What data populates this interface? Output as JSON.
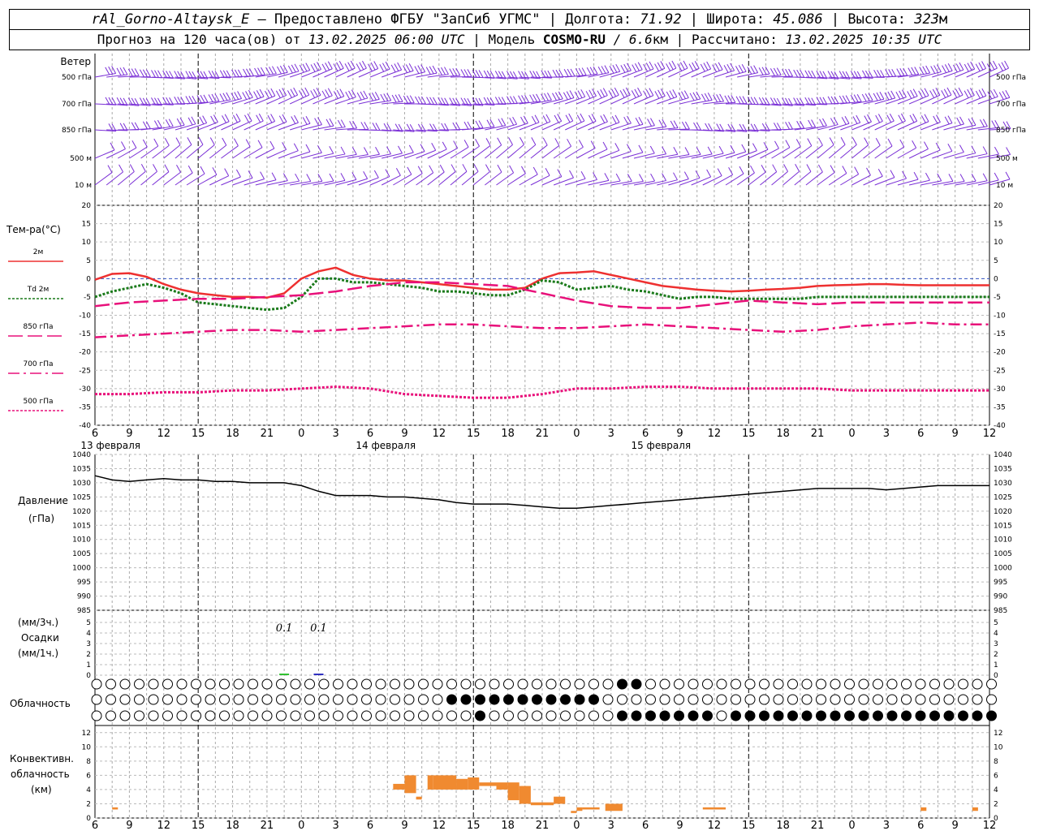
{
  "header": {
    "station": "rAl_Gorno-Altaysk_E",
    "provided_prefix": "– Предоставлено ФГБУ \"ЗапСиб УГМС\"",
    "lon_label": "Долгота:",
    "lon_value": "71.92",
    "lat_label": "Широта:",
    "lat_value": "45.086",
    "alt_label": "Высота:",
    "alt_value": "323",
    "alt_unit": "м",
    "forecast_prefix": "Прогноз на 120 часа(ов) от",
    "forecast_time": "13.02.2025 06:00 UTC",
    "model_label": "| Модель",
    "model_name": "COSMO-RU",
    "model_res": "/ 6.6",
    "model_res_unit": "км",
    "calc_label": "| Рассчитано:",
    "calc_time": "13.02.2025 10:35 UTC"
  },
  "x_ticks": [
    "6",
    "9",
    "12",
    "15",
    "18",
    "21",
    "0",
    "3",
    "6",
    "9",
    "12",
    "15",
    "18",
    "21",
    "0",
    "3",
    "6",
    "9",
    "12",
    "15",
    "18",
    "21",
    "0",
    "3",
    "6",
    "9",
    "12"
  ],
  "dates": [
    "13 февраля",
    "14 февраля",
    "15 февраля"
  ],
  "wind": {
    "title": "Ветер",
    "levels": [
      "500 гПа",
      "700 гПа",
      "850 гПа",
      "500 м",
      "10 м"
    ],
    "color": "#7a2fd6"
  },
  "temperature": {
    "title": "Тем-ра(°С)",
    "legend": [
      {
        "label": "2м",
        "color": "#ee3030",
        "dash": "solid"
      },
      {
        "label": "Td  2м",
        "color": "#1a7a1a",
        "dash": "dotted"
      },
      {
        "label": "850 гПа",
        "color": "#e8107a",
        "dash": "long-dash"
      },
      {
        "label": "700 гПа",
        "color": "#e8107a",
        "dash": "dash-dot"
      },
      {
        "label": "500 гПа",
        "color": "#e8107a",
        "dash": "dotted"
      }
    ],
    "y_ticks": [
      "20",
      "15",
      "10",
      "5",
      "0",
      "-5",
      "-10",
      "-15",
      "-20",
      "-25",
      "-30",
      "-35",
      "-40"
    ]
  },
  "pressure": {
    "title": "Давление",
    "unit": "(гПа)",
    "y_ticks": [
      "1040",
      "1035",
      "1030",
      "1025",
      "1020",
      "1015",
      "1010",
      "1005",
      "1000",
      "995",
      "990",
      "985"
    ]
  },
  "precip": {
    "unit_top": "(мм/3ч.)",
    "title": "Осадки",
    "unit_bottom": "(мм/1ч.)",
    "y_ticks": [
      "5",
      "4",
      "3",
      "2",
      "1",
      "0"
    ],
    "labels": [
      {
        "hour": 33,
        "text": "0.1"
      },
      {
        "hour": 39,
        "text": "0.1"
      }
    ]
  },
  "cloud": {
    "title": "Облачность"
  },
  "convective": {
    "title_1": "Конвективн.",
    "title_2": "облачность",
    "title_3": "(км)",
    "y_ticks": [
      "12",
      "10",
      "8",
      "6",
      "4",
      "2",
      "0"
    ],
    "color": "#f08a30"
  },
  "chart_data": [
    {
      "type": "line",
      "title": "Тем-ра(°С)",
      "x_unit": "hours from 13.02.2025 06:00 UTC",
      "ylim": [
        -40,
        20
      ],
      "series": [
        {
          "name": "2м",
          "x": [
            0,
            3,
            6,
            9,
            12,
            15,
            18,
            21,
            24,
            27,
            30,
            33,
            36,
            39,
            42,
            45,
            48,
            51,
            54,
            57,
            60,
            63,
            66,
            69,
            72,
            75,
            78,
            81,
            84,
            87,
            90,
            93,
            96,
            99,
            102,
            105,
            108,
            111,
            114,
            117,
            120,
            123,
            126,
            129,
            132,
            135,
            138,
            141,
            144,
            147,
            150,
            153,
            156
          ],
          "values": [
            -0.3,
            1.3,
            1.5,
            0.5,
            -1.5,
            -3,
            -4,
            -4.5,
            -5,
            -5,
            -5.2,
            -4,
            0,
            2,
            3,
            1,
            0,
            -0.5,
            -0.5,
            -1,
            -1.5,
            -2,
            -2.5,
            -3,
            -3,
            -2.5,
            0,
            1.5,
            1.7,
            2,
            1,
            0,
            -1,
            -2,
            -2.5,
            -3,
            -3.3,
            -3.5,
            -3.3,
            -3,
            -2.8,
            -2.5,
            -2,
            -1.8,
            -1.7,
            -1.5,
            -1.5,
            -1.7,
            -1.8,
            -1.8,
            -1.8,
            -1.8,
            -1.8
          ]
        },
        {
          "name": "Td 2м",
          "x": [
            0,
            3,
            6,
            9,
            12,
            15,
            18,
            21,
            24,
            27,
            30,
            33,
            36,
            39,
            42,
            45,
            48,
            51,
            54,
            57,
            60,
            63,
            66,
            69,
            72,
            75,
            78,
            81,
            84,
            87,
            90,
            93,
            96,
            99,
            102,
            105,
            108,
            111,
            114,
            117,
            120,
            123,
            126,
            129,
            132,
            135,
            138,
            141,
            144,
            147,
            150,
            153,
            156
          ],
          "values": [
            -5,
            -3.5,
            -2.5,
            -1.5,
            -2.5,
            -4,
            -6.5,
            -7,
            -7.5,
            -8,
            -8.5,
            -8,
            -5,
            0,
            0,
            -1,
            -1,
            -1.5,
            -2,
            -2.5,
            -3.5,
            -3.5,
            -4,
            -4.5,
            -4.5,
            -3,
            -0.5,
            -1,
            -3,
            -2.5,
            -2,
            -3,
            -3.5,
            -4.5,
            -5.5,
            -5,
            -5,
            -5.5,
            -5.5,
            -5.5,
            -5.5,
            -5.5,
            -5,
            -5,
            -5,
            -5,
            -5,
            -5,
            -5,
            -5,
            -5,
            -5,
            -5
          ]
        },
        {
          "name": "850 гПа",
          "x": [
            0,
            6,
            12,
            18,
            24,
            30,
            36,
            42,
            48,
            54,
            60,
            66,
            72,
            78,
            84,
            90,
            96,
            102,
            108,
            114,
            120,
            126,
            132,
            138,
            144,
            150,
            156
          ],
          "values": [
            -7.5,
            -6.5,
            -6,
            -5.5,
            -5.5,
            -5,
            -4.5,
            -3.5,
            -2,
            -1,
            -1,
            -1.5,
            -2,
            -4,
            -6,
            -7.5,
            -8,
            -8,
            -7,
            -6,
            -6.5,
            -7,
            -6.5,
            -6.5,
            -6.5,
            -6.5,
            -6.5
          ]
        },
        {
          "name": "700 гПа",
          "x": [
            0,
            6,
            12,
            18,
            24,
            30,
            36,
            42,
            48,
            54,
            60,
            66,
            72,
            78,
            84,
            90,
            96,
            102,
            108,
            114,
            120,
            126,
            132,
            138,
            144,
            150,
            156
          ],
          "values": [
            -16,
            -15.5,
            -15,
            -14.5,
            -14,
            -14,
            -14.5,
            -14,
            -13.5,
            -13,
            -12.5,
            -12.5,
            -13,
            -13.5,
            -13.5,
            -13,
            -12.5,
            -13,
            -13.5,
            -14,
            -14.5,
            -14,
            -13,
            -12.5,
            -12,
            -12.5,
            -12.5
          ]
        },
        {
          "name": "500 гПа",
          "x": [
            0,
            6,
            12,
            18,
            24,
            30,
            36,
            42,
            48,
            54,
            60,
            66,
            72,
            78,
            84,
            90,
            96,
            102,
            108,
            114,
            120,
            126,
            132,
            138,
            144,
            150,
            156
          ],
          "values": [
            -31.5,
            -31.5,
            -31,
            -31,
            -30.5,
            -30.5,
            -30,
            -29.5,
            -30,
            -31.5,
            -32,
            -32.5,
            -32.5,
            -31.5,
            -30,
            -30,
            -29.5,
            -29.5,
            -30,
            -30,
            -30,
            -30,
            -30.5,
            -30.5,
            -30.5,
            -30.5,
            -30.5
          ]
        }
      ]
    },
    {
      "type": "line",
      "title": "Давление",
      "ylabel": "(гПа)",
      "x_unit": "hours from 13.02.2025 06:00 UTC",
      "ylim": [
        985,
        1040
      ],
      "series": [
        {
          "name": "Давление",
          "x": [
            0,
            3,
            6,
            9,
            12,
            15,
            18,
            21,
            24,
            27,
            30,
            33,
            36,
            39,
            42,
            45,
            48,
            51,
            54,
            57,
            60,
            63,
            66,
            69,
            72,
            75,
            78,
            81,
            84,
            87,
            90,
            93,
            96,
            99,
            102,
            105,
            108,
            111,
            114,
            117,
            120,
            123,
            126,
            129,
            132,
            135,
            138,
            141,
            144,
            147,
            150,
            153,
            156
          ],
          "values": [
            1032.5,
            1031,
            1030.5,
            1031,
            1031.5,
            1031,
            1031,
            1030.5,
            1030.5,
            1030,
            1030,
            1030,
            1029,
            1027,
            1025.5,
            1025.5,
            1025.5,
            1025,
            1025,
            1024.5,
            1024,
            1023,
            1022.5,
            1022.5,
            1022.5,
            1022,
            1021.5,
            1021,
            1021,
            1021.5,
            1022,
            1022.5,
            1023,
            1023.5,
            1024,
            1024.5,
            1025,
            1025.5,
            1026,
            1026.5,
            1027,
            1027.5,
            1028,
            1028,
            1028,
            1028,
            1027.5,
            1028,
            1028.5,
            1029,
            1029,
            1029,
            1029
          ]
        }
      ]
    },
    {
      "type": "bar",
      "title": "Осадки",
      "ylabel": "(мм/3ч.)",
      "x_unit": "hours from 13.02.2025 06:00 UTC",
      "ylim": [
        0,
        5
      ],
      "series": [
        {
          "name": "мм/3ч.",
          "x": [
            33,
            39
          ],
          "values": [
            0.1,
            0.1
          ]
        }
      ]
    },
    {
      "type": "bar",
      "title": "Конвективн. облачность",
      "ylabel": "(км)",
      "x_unit": "hours from 13.02.2025 06:00 UTC",
      "ylim": [
        0,
        13
      ],
      "series": [
        {
          "name": "Конвективн. облачность",
          "segments": [
            {
              "x0": 3,
              "x1": 4,
              "bottom": 1.2,
              "top": 1.5
            },
            {
              "x0": 52,
              "x1": 54,
              "bottom": 4,
              "top": 4.8
            },
            {
              "x0": 54,
              "x1": 56,
              "bottom": 3.5,
              "top": 6
            },
            {
              "x0": 56,
              "x1": 57,
              "bottom": 2.6,
              "top": 3
            },
            {
              "x0": 58,
              "x1": 59,
              "bottom": 4,
              "top": 6
            },
            {
              "x0": 59,
              "x1": 63,
              "bottom": 4,
              "top": 6
            },
            {
              "x0": 63,
              "x1": 65,
              "bottom": 4,
              "top": 5.5
            },
            {
              "x0": 65,
              "x1": 67,
              "bottom": 4,
              "top": 5.7
            },
            {
              "x0": 67,
              "x1": 70,
              "bottom": 4.5,
              "top": 5
            },
            {
              "x0": 70,
              "x1": 72,
              "bottom": 4,
              "top": 5
            },
            {
              "x0": 72,
              "x1": 74,
              "bottom": 2.5,
              "top": 5
            },
            {
              "x0": 74,
              "x1": 76,
              "bottom": 2,
              "top": 4.5
            },
            {
              "x0": 76,
              "x1": 78,
              "bottom": 1.8,
              "top": 2.2
            },
            {
              "x0": 78,
              "x1": 80,
              "bottom": 1.8,
              "top": 2.2
            },
            {
              "x0": 80,
              "x1": 82,
              "bottom": 2,
              "top": 3
            },
            {
              "x0": 83,
              "x1": 84,
              "bottom": 0.7,
              "top": 1
            },
            {
              "x0": 84,
              "x1": 85,
              "bottom": 1,
              "top": 1.5
            },
            {
              "x0": 85,
              "x1": 88,
              "bottom": 1.2,
              "top": 1.5
            },
            {
              "x0": 89,
              "x1": 92,
              "bottom": 1,
              "top": 2
            },
            {
              "x0": 106,
              "x1": 108,
              "bottom": 1.2,
              "top": 1.5
            },
            {
              "x0": 108,
              "x1": 110,
              "bottom": 1.2,
              "top": 1.5
            },
            {
              "x0": 144,
              "x1": 145,
              "bottom": 1,
              "top": 1.5
            },
            {
              "x0": 153,
              "x1": 154,
              "bottom": 1,
              "top": 1.5
            }
          ]
        }
      ]
    }
  ]
}
